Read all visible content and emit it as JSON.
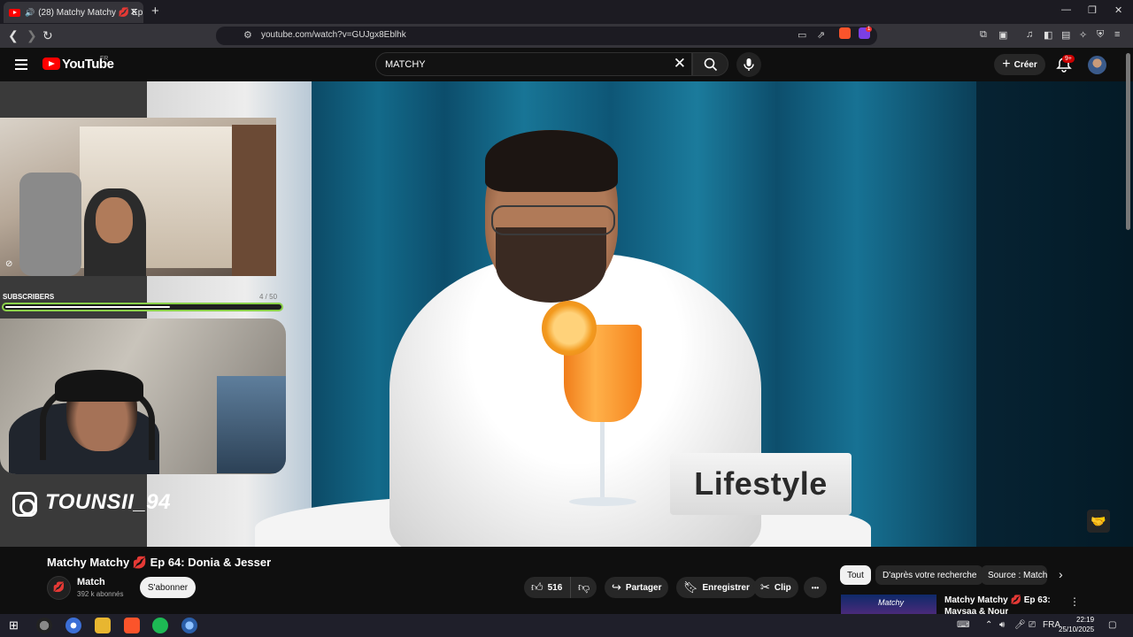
{
  "browser": {
    "tab_title": "(28) Matchy Matchy 💋 Ep 64",
    "new_tab": "+",
    "url": "youtube.com/watch?v=GUJgx8Eblhk",
    "window_minimize": "—",
    "window_restore": "❐",
    "window_close": "✕",
    "brave_badge": "1"
  },
  "youtube": {
    "logo_text": "YouTube",
    "region": "FR",
    "search_value": "MATCHY",
    "create_label": "Créer",
    "notifications_badge": "9+"
  },
  "overlay": {
    "subscribers_label": "SUBSCRIBERS",
    "subscribers_count": "4 / 50",
    "subscribers_progress_percent": 60,
    "instagram_handle": "TOUNSII_94",
    "sign_text": "Lifestyle"
  },
  "video": {
    "title": "Matchy Matchy 💋 Ep 64: Donia & Jesser",
    "channel_name": "Match",
    "channel_subs": "392 k abonnés",
    "subscribe_label": "S'abonner",
    "likes": "516",
    "share_label": "Partager",
    "save_label": "Enregistrer",
    "clip_label": "Clip",
    "more_label": "•••"
  },
  "filters": [
    {
      "label": "Tout",
      "selected": true
    },
    {
      "label": "D'après votre recherche",
      "selected": false
    },
    {
      "label": "Source : Match",
      "selected": false
    }
  ],
  "recommendation": {
    "title_line1": "Matchy Matchy 💋 Ep 63:",
    "title_line2": "Maysaa & Nour",
    "thumb_text": "Matchy"
  },
  "taskbar": {
    "language": "FRA",
    "time": "22:19",
    "date": "25/10/2025"
  },
  "colors": {
    "youtube_red": "#ff0000",
    "subscriber_bar_border": "#8bd14a",
    "notification_red": "#cc0000"
  }
}
